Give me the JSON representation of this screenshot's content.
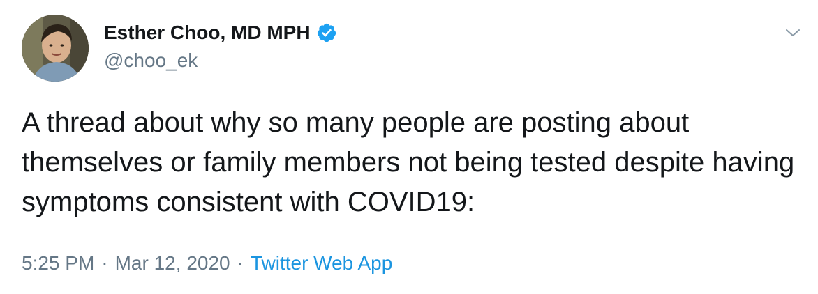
{
  "author": {
    "display_name": "Esther Choo, MD MPH",
    "handle": "@choo_ek",
    "verified": true,
    "avatar_icon": "profile-photo"
  },
  "menu": {
    "icon": "chevron-down-icon"
  },
  "tweet": {
    "text": "A thread about why so many people are posting about themselves or family members not being tested despite having symptoms consistent with COVID19:"
  },
  "meta": {
    "time": "5:25 PM",
    "separator": "·",
    "date": "Mar 12, 2020",
    "source": "Twitter Web App"
  },
  "colors": {
    "verified_blue": "#1da1f2",
    "link_blue": "#1b95e0",
    "muted_gray": "#657786",
    "text_dark": "#14171a"
  }
}
